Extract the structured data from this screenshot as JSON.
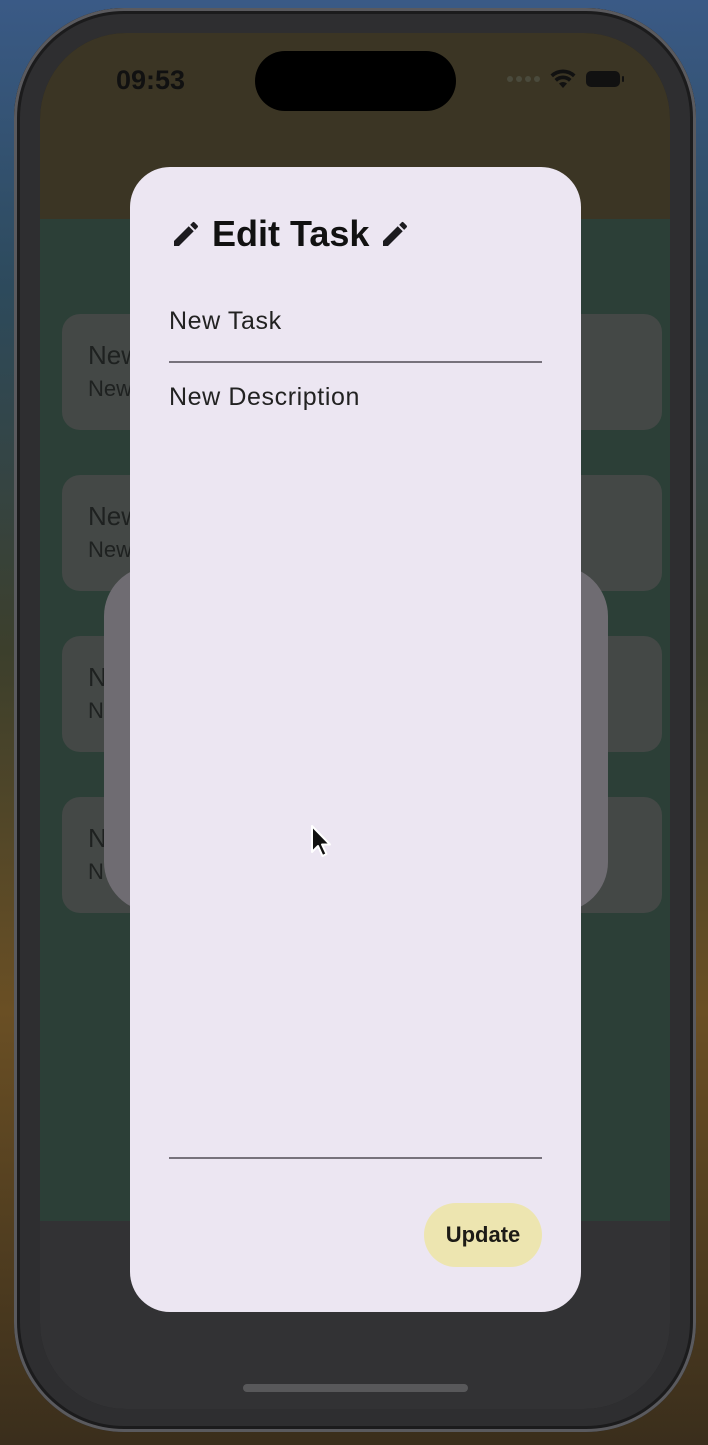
{
  "status_bar": {
    "time": "09:53"
  },
  "app": {
    "title": "",
    "tasks": [
      {
        "title": "New",
        "description": "New"
      },
      {
        "title": "New",
        "description": "New"
      },
      {
        "title": "N",
        "description": "N"
      },
      {
        "title": "N",
        "description": "N"
      }
    ]
  },
  "dialog": {
    "title": "Edit Task",
    "title_field_value": "New Task",
    "description_field_value": "New Description",
    "update_label": "Update",
    "icons": {
      "leading": "pencil-icon",
      "trailing": "pencil-icon"
    }
  },
  "colors": {
    "dialog_background": "#ece6f2",
    "update_button": "#ede5b0",
    "scrim_body": "#2c3f37"
  }
}
